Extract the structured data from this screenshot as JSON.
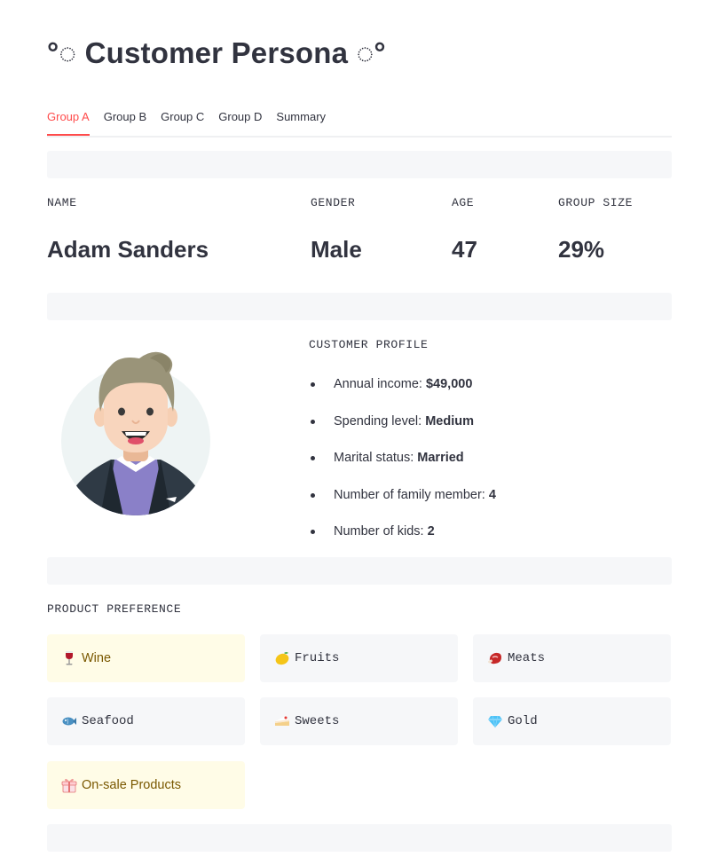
{
  "page": {
    "title": "°◌ Customer Persona ◌°"
  },
  "tabs": [
    {
      "label": "Group A",
      "active": true
    },
    {
      "label": "Group B",
      "active": false
    },
    {
      "label": "Group C",
      "active": false
    },
    {
      "label": "Group D",
      "active": false
    },
    {
      "label": "Summary",
      "active": false
    }
  ],
  "metrics": {
    "name": {
      "label": "NAME",
      "value": "Adam Sanders"
    },
    "gender": {
      "label": "GENDER",
      "value": "Male"
    },
    "age": {
      "label": "AGE",
      "value": "47"
    },
    "group_size": {
      "label": "GROUP SIZE",
      "value": "29%"
    }
  },
  "profile": {
    "heading": "CUSTOMER PROFILE",
    "items": [
      {
        "label": "Annual income:",
        "value": "$49,000"
      },
      {
        "label": "Spending level:",
        "value": "Medium"
      },
      {
        "label": "Marital status:",
        "value": "Married"
      },
      {
        "label": "Number of family member:",
        "value": "4"
      },
      {
        "label": "Number of kids:",
        "value": "2"
      }
    ]
  },
  "preferences": {
    "heading": "PRODUCT PREFERENCE",
    "items": [
      {
        "label": "Wine",
        "icon": "wine-glass-icon",
        "highlighted": true
      },
      {
        "label": "Fruits",
        "icon": "lemon-icon",
        "highlighted": false
      },
      {
        "label": "Meats",
        "icon": "meat-icon",
        "highlighted": false
      },
      {
        "label": "Seafood",
        "icon": "fish-icon",
        "highlighted": false
      },
      {
        "label": "Sweets",
        "icon": "cake-icon",
        "highlighted": false
      },
      {
        "label": "Gold",
        "icon": "gem-icon",
        "highlighted": false
      },
      {
        "label": "On-sale Products",
        "icon": "gift-icon",
        "highlighted": true
      }
    ]
  },
  "colors": {
    "accent": "#ff4b4b",
    "text": "#31333f",
    "card_bg": "#f6f7f9",
    "highlight_bg": "#fffce7",
    "highlight_text": "#7a5800"
  }
}
